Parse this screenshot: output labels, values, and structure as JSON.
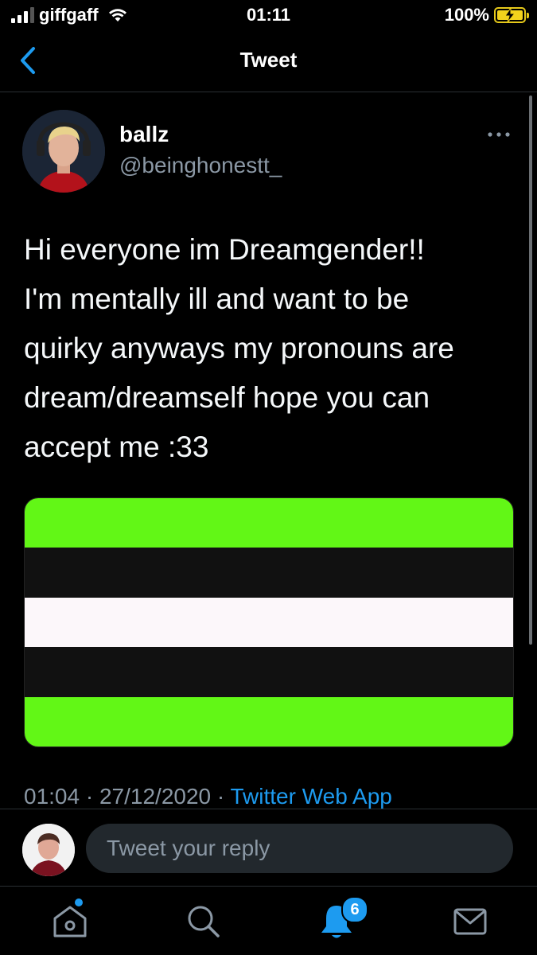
{
  "status_bar": {
    "carrier": "giffgaff",
    "time": "01:11",
    "battery": "100%",
    "battery_level": 1.0,
    "icons": [
      "signal-icon",
      "wifi-icon",
      "battery-charging-icon"
    ]
  },
  "header": {
    "title": "Tweet",
    "back_icon": "chevron-left-icon"
  },
  "tweet": {
    "author_name": "ballz",
    "author_handle": "@beinghonestt_",
    "more_icon": "more-horizontal-icon",
    "text_lines": [
      "Hi everyone im Dreamgender!!",
      "I'm mentally ill and want to be",
      "quirky anyways my pronouns are",
      "dream/dreamself hope you can",
      "accept me :33"
    ],
    "image_stripes": [
      "#62f716",
      "#111111",
      "#fcf7fa",
      "#111111",
      "#62f716"
    ],
    "time": "01:04",
    "date": "27/12/2020",
    "separator": "·",
    "source": "Twitter Web App"
  },
  "reply": {
    "placeholder": "Tweet your reply"
  },
  "tab_bar": {
    "items": [
      {
        "name": "home",
        "icon": "home-icon"
      },
      {
        "name": "search",
        "icon": "search-icon"
      },
      {
        "name": "notifications",
        "icon": "bell-icon"
      },
      {
        "name": "messages",
        "icon": "mail-icon"
      }
    ],
    "notifications_badge": "6"
  },
  "colors": {
    "background": "#000000",
    "accent": "#1d9bf0",
    "secondary_text": "#8b98a5",
    "reply_field": "#22282d"
  }
}
